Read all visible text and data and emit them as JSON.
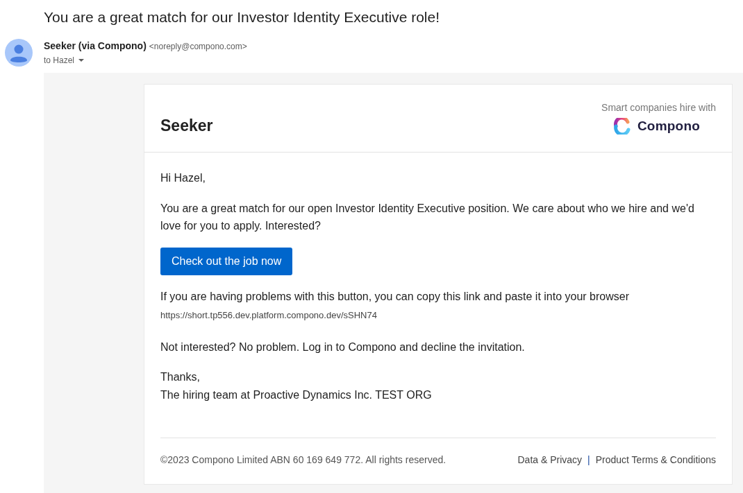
{
  "email": {
    "subject": "You are a great match for our Investor Identity Executive role!",
    "sender": {
      "name": "Seeker (via Compono)",
      "address": "<noreply@compono.com>",
      "recipient": "to Hazel"
    },
    "message": {
      "header": {
        "brand": "Seeker",
        "tagline": "Smart companies hire with",
        "logo_text": "Compono"
      },
      "greeting": "Hi Hazel,",
      "intro": "You are a great match for our open Investor Identity Executive position. We care about who we hire and we'd love for you to apply. Interested?",
      "button": "Check out the job now",
      "link_note": "If you are having problems with this button, you can copy this link and paste it into your browser",
      "link": "https://short.tp556.dev.platform.compono.dev/sSHN74",
      "decline_note": "Not interested? No problem. Log in to Compono and decline the invitation.",
      "signoff": [
        "Thanks,",
        "The hiring team at Proactive Dynamics Inc. TEST ORG"
      ],
      "footer": {
        "copyright": "©2023 Compono Limited ABN 60 169 649 772. All rights reserved.",
        "links": [
          "Data & Privacy",
          "Product Terms & Conditions"
        ],
        "separator": "|"
      }
    }
  }
}
